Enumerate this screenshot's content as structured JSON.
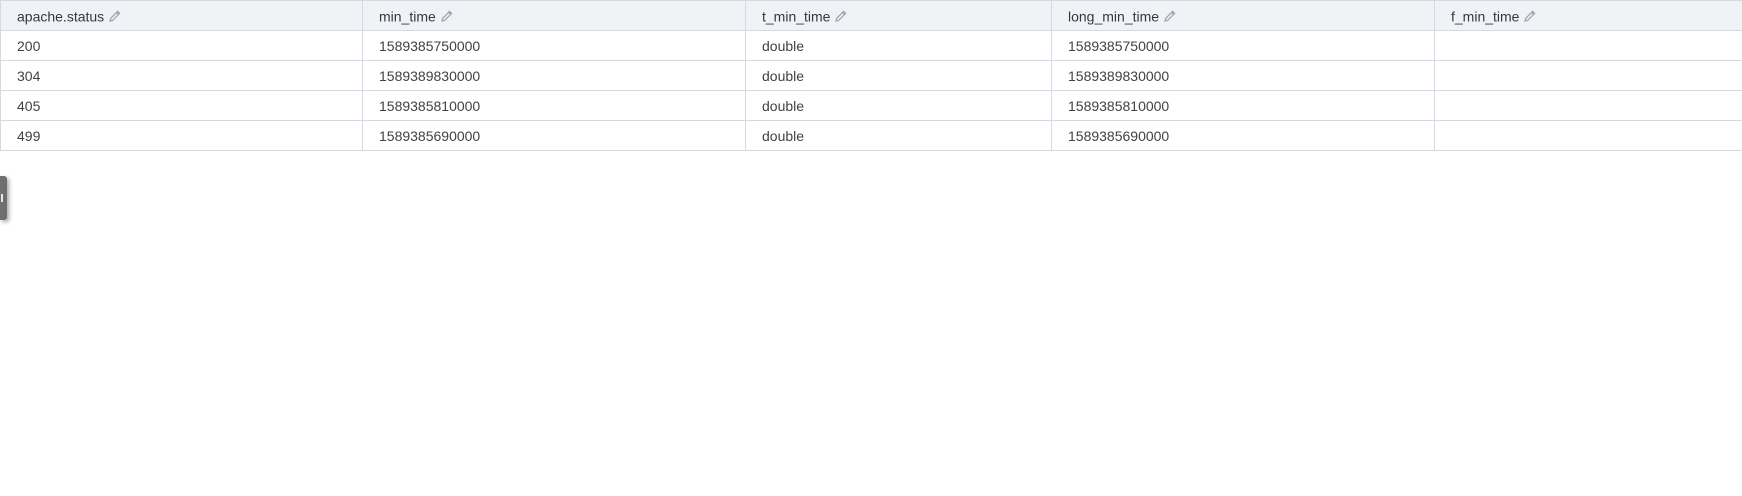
{
  "table": {
    "columns": [
      {
        "label": "apache.status",
        "icon": "pencil-icon"
      },
      {
        "label": "min_time",
        "icon": "pencil-icon"
      },
      {
        "label": "t_min_time",
        "icon": "pencil-icon"
      },
      {
        "label": "long_min_time",
        "icon": "pencil-icon"
      },
      {
        "label": "f_min_time",
        "icon": "pencil-icon"
      }
    ],
    "rows": [
      [
        "200",
        "1589385750000",
        "double",
        "1589385750000",
        ""
      ],
      [
        "304",
        "1589389830000",
        "double",
        "1589389830000",
        ""
      ],
      [
        "405",
        "1589385810000",
        "double",
        "1589385810000",
        ""
      ],
      [
        "499",
        "1589385690000",
        "double",
        "1589385690000",
        ""
      ]
    ]
  },
  "colors": {
    "header_background": "#f0f3f6",
    "border": "#d3dae6",
    "text": "#343741",
    "edit_icon": "#98a2b3",
    "side_tab": "#6f6f6f"
  }
}
